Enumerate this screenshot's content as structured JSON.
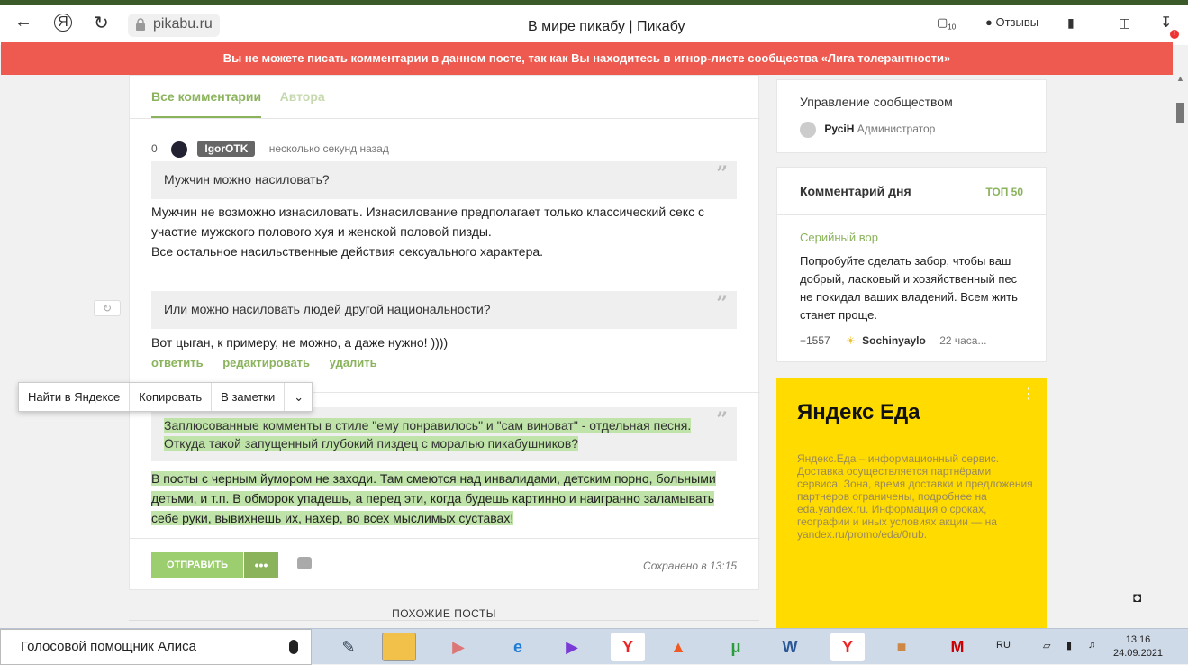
{
  "browser": {
    "url": "pikabu.ru",
    "title": "В мире пикабу | Пикабу",
    "reviews_label": "Отзывы",
    "tabs_badge": "10",
    "download_badge": "!",
    "yandex_btn": "Я"
  },
  "banner": {
    "text": "Вы не можете писать комментарии в данном посте, так как Вы находитесь в игнор-листе сообщества «Лига толерантности»"
  },
  "comments": {
    "tabs": [
      "Все комментарии",
      "Автора"
    ],
    "rating": "0",
    "author": "IgorOTK",
    "time": "несколько секунд назад",
    "quote1": "Мужчин можно насиловать?",
    "text1_line1": "Мужчин не возможно изнасиловать. Изнасилование предполагает только классический секс с",
    "text1_line2": "участие мужского полового хуя и женской половой пизды.",
    "text1_line3": "Все остальное насильственные действия сексуального характера.",
    "quote2": "Или можно насиловать людей другой национальности?",
    "text2": "Вот цыган, к примеру, не можно, а даже нужно! ))))",
    "actions": [
      "ответить",
      "редактировать",
      "удалить"
    ],
    "quote3_line1": "Заплюсованные комменты в стиле \"ему понравилось\" и \"сам виноват\" - отдельная песня.",
    "quote3_line2": "Откуда такой запущенный глубокий пиздец с моралью пикабушников?",
    "text3_line1": "В посты с черным йумором не заходи. Там смеются над инвалидами, детским порно, больными",
    "text3_line2": "детьми, и т.п. В обморок упадешь, а перед эти, когда будешь картинно и наигранно заламывать",
    "text3_line3": "себе руки, вывихнешь их, нахер, во всех мыслимых суставах!",
    "send_label": "ОТПРАВИТЬ",
    "more_label": "•••",
    "saved": "Сохранено в 13:15"
  },
  "context_menu": [
    "Найти в Яндексе",
    "Копировать",
    "В заметки"
  ],
  "similar": "ПОХОЖИЕ ПОСТЫ",
  "sidebar": {
    "manage_title": "Управление сообществом",
    "admin_name": "РусiН",
    "admin_role": "Администратор",
    "cod_title": "Комментарий дня",
    "cod_top": "ТОП 50",
    "cod_post": "Серийный вор",
    "cod_text": "Попробуйте сделать забор, чтобы ваш добрый, ласковый и хозяйственный пес не покидал ваших владений. Всем жить станет проще.",
    "cod_rating": "+1557",
    "cod_user": "Sochinyaylo",
    "cod_time": "22 часа..."
  },
  "ad": {
    "logo": "Яндекс Еда",
    "text": "Яндекс.Еда – информационный сервис. Доставка осуществляется партнёрами сервиса. Зона, время доставки и предложения партнеров ограничены, подробнее на eda.yandex.ru. Информация о сроках, географии и иных условиях акции — на yandex.ru/promo/eda/0rub."
  },
  "taskbar": {
    "search": "Голосовой помощник Алиса",
    "lang": "RU",
    "time": "13:16",
    "date": "24.09.2021"
  },
  "colors": {
    "accent": "#8ab35c",
    "banner": "#ee5a4f",
    "highlight": "#bfe3a8",
    "ad_bg": "#ffdb00"
  }
}
